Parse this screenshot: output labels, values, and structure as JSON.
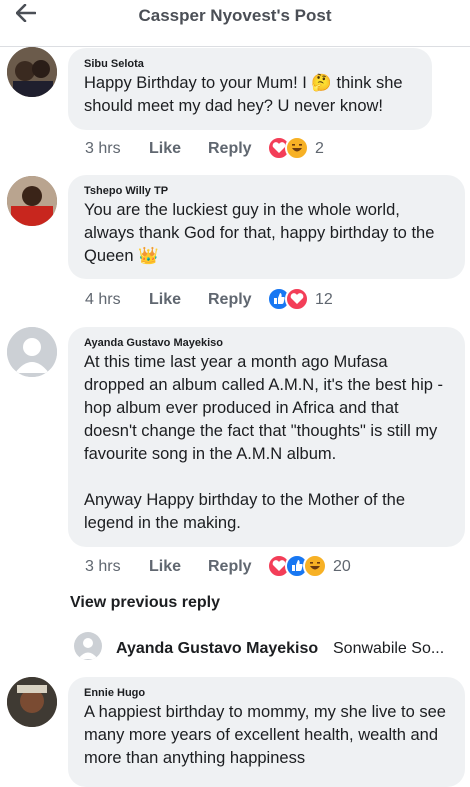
{
  "header": {
    "title": "Cassper Nyovest's Post",
    "back_icon": "back-arrow-icon"
  },
  "comments": [
    {
      "name": "Sibu Selota",
      "text": "Happy Birthday to your Mum! I 🤔 think she should meet my dad hey? U never know!",
      "time": "3 hrs",
      "like": "Like",
      "reply": "Reply",
      "reaction_count": "2",
      "reactions": [
        "love-reaction-icon",
        "haha-reaction-icon"
      ]
    },
    {
      "name": "Tshepo Willy TP",
      "text": "You are the luckiest guy in the whole world, always thank God for that, happy birthday to the Queen 👑",
      "time": "4 hrs",
      "like": "Like",
      "reply": "Reply",
      "reaction_count": "12",
      "reactions": [
        "like-reaction-icon",
        "love-reaction-icon"
      ]
    },
    {
      "name": "Ayanda Gustavo Mayekiso",
      "text": "At this time last year a month ago Mufasa dropped an album called A.M.N, it's the best hip -hop album ever produced in Africa and that doesn't change the fact that \"thoughts\" is still my favourite song in the A.M.N album.\n\nAnyway Happy birthday to the Mother of the legend in the making.",
      "time": "3 hrs",
      "like": "Like",
      "reply": "Reply",
      "reaction_count": "20",
      "reactions": [
        "love-reaction-icon",
        "like-reaction-icon",
        "haha-reaction-icon"
      ]
    },
    {
      "name": "Ennie Hugo",
      "text": "A happiest birthday to mommy, my she live to see many more years of excellent health, wealth and more than anything happiness"
    }
  ],
  "view_previous": "View previous reply",
  "nested_reply": {
    "name": "Ayanda Gustavo Mayekiso",
    "text": "Sonwabile So..."
  },
  "colors": {
    "bubble": "#eff1f3",
    "love": "#f33e58",
    "like": "#1877f2",
    "haha": "#f7b125"
  }
}
